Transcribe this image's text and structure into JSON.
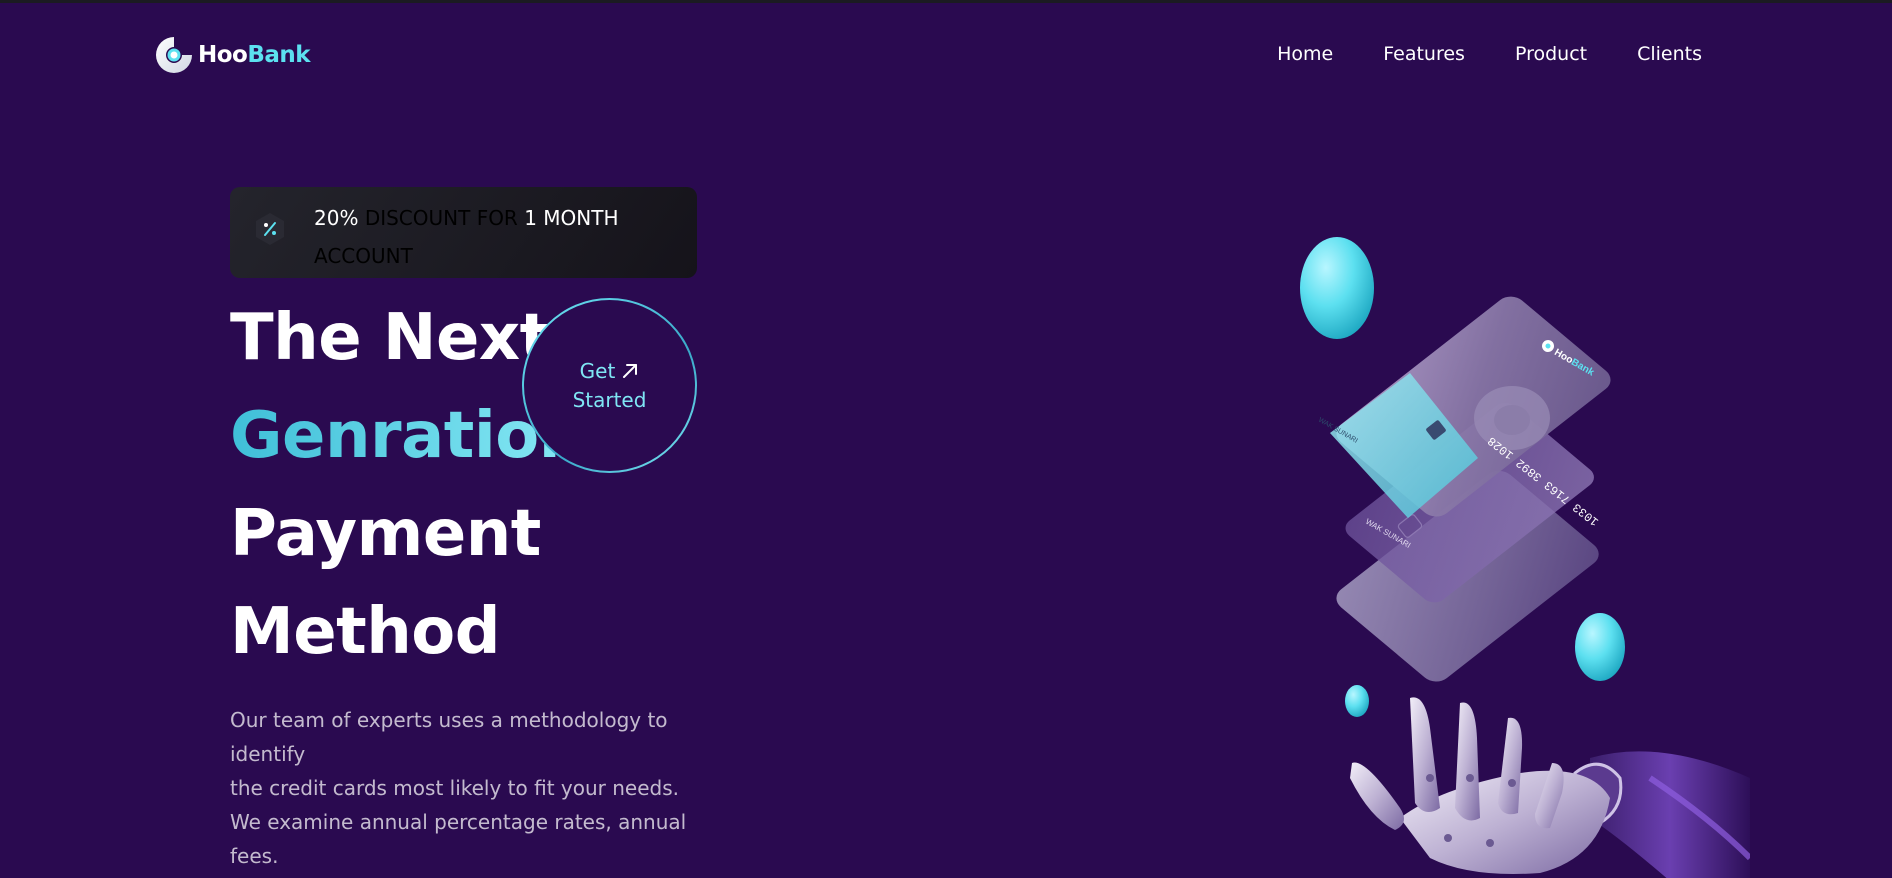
{
  "brand": {
    "name_part1": "Hoo",
    "name_part2": "Bank",
    "logo_icon": "hoobank-logo-icon"
  },
  "nav": {
    "items": [
      {
        "label": "Home"
      },
      {
        "label": "Features"
      },
      {
        "label": "Product"
      },
      {
        "label": "Clients"
      }
    ]
  },
  "discount": {
    "icon": "discount-percent-icon",
    "percent": "20%",
    "middle": "DISCOUNT FOR",
    "duration": "1 MONTH",
    "trailing": "ACCOUNT"
  },
  "hero": {
    "title_line1": "The Next",
    "title_line2": "Genration",
    "title_line3": "Payment",
    "title_line4": "Method",
    "cta_line1": "Get",
    "cta_line2": "Started",
    "cta_icon": "arrow-up-right-icon",
    "description_line1": "Our team of experts uses a methodology to identify",
    "description_line2": "the credit cards most likely to fit your needs.",
    "description_line3": "We examine annual percentage rates, annual fees."
  },
  "illustration": {
    "card_number": "1033 7163 3892 1028",
    "card_holder": "WAK SUNARI",
    "card_brand_part1": "Hoo",
    "card_brand_part2": "Bank"
  },
  "colors": {
    "background": "#2a0a50",
    "accent": "#5ce1f0",
    "banner": "#1b1a21"
  }
}
